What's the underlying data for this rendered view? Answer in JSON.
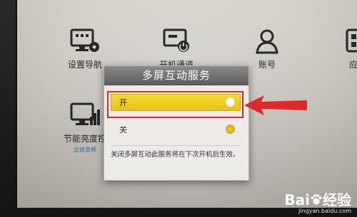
{
  "tiles": [
    {
      "label": "设置导航",
      "icon": "settings-display-icon"
    },
    {
      "label": "开机通道",
      "icon": "power-channel-icon"
    },
    {
      "label": "账号",
      "icon": "user-icon"
    },
    {
      "label": "应用",
      "icon": "app-icon"
    },
    {
      "label": "节能亮度控",
      "sublabel": "立体变频",
      "icon": "energy-brightness-icon"
    }
  ],
  "dialog": {
    "title": "多屏互动服务",
    "options": [
      {
        "label": "开",
        "selected": true
      },
      {
        "label": "关",
        "selected": false
      }
    ],
    "note": "关闭多屏互动此服务将在下次开机后生效。"
  },
  "watermark": {
    "logo_left": "Bai",
    "logo_right": "经验",
    "url": "jingyan.baidu.com"
  },
  "colors": {
    "highlight": "#f3d32a",
    "annotation": "#e0272b",
    "link": "#3a73b8"
  }
}
